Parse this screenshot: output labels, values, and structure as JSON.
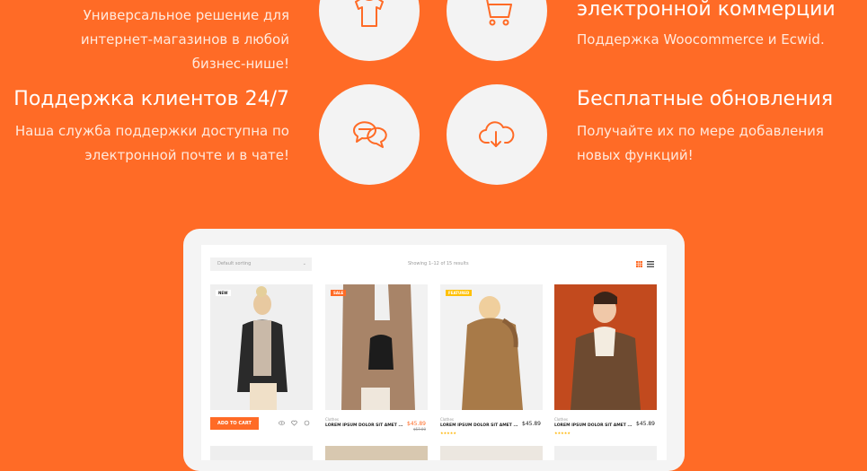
{
  "features": [
    {
      "id": "universal",
      "side": "left",
      "title": "",
      "desc_lines": [
        "Универсальное решение для",
        "интернет-магазинов в любой",
        "бизнес-нише!"
      ],
      "icon": "tshirt-icon"
    },
    {
      "id": "support",
      "side": "left",
      "title": "Поддержка клиентов 24/7",
      "desc_lines": [
        "Наша служба поддержки доступна по",
        "электронной почте и в чате!"
      ],
      "icon": "chat-bubbles-icon"
    },
    {
      "id": "ecommerce",
      "side": "right",
      "title": "электронной коммерции",
      "desc_lines": [
        "Поддержка Woocommerce и Ecwid."
      ],
      "icon": "cart-icon"
    },
    {
      "id": "updates",
      "side": "right",
      "title": "Бесплатные обновления",
      "desc_lines": [
        "Получайте их по мере добавления",
        "новых функций!"
      ],
      "icon": "cloud-download-icon"
    }
  ],
  "mock": {
    "sort_label": "Default sorting",
    "results_text": "Showing 1–12 of 15 results",
    "add_to_cart": "ADD TO CART",
    "products": [
      {
        "badge": "NEW",
        "badge_color": "#ffffff",
        "badge_text_color": "#222222",
        "category": "",
        "name": "",
        "price": "",
        "old_price": "",
        "rating": 0
      },
      {
        "badge": "SALE",
        "badge_color": "#ff6b26",
        "category": "Clothes",
        "name": "LOREM IPSUM DOLOR SIT AMET ...",
        "price": "$45.89",
        "old_price": "$57.00",
        "rating": 0
      },
      {
        "badge": "FEATURED",
        "badge_color": "#ffc107",
        "category": "Clothes",
        "name": "LOREM IPSUM DOLOR SIT AMET ...",
        "price": "$45.89",
        "old_price": "",
        "rating": 5
      },
      {
        "badge": "",
        "badge_color": "",
        "category": "Clothes",
        "name": "LOREM IPSUM DOLOR SIT AMET ...",
        "price": "$45.89",
        "old_price": "",
        "rating": 5
      }
    ]
  },
  "colors": {
    "accent": "#ff6b26",
    "circle": "#f3f3f3"
  }
}
